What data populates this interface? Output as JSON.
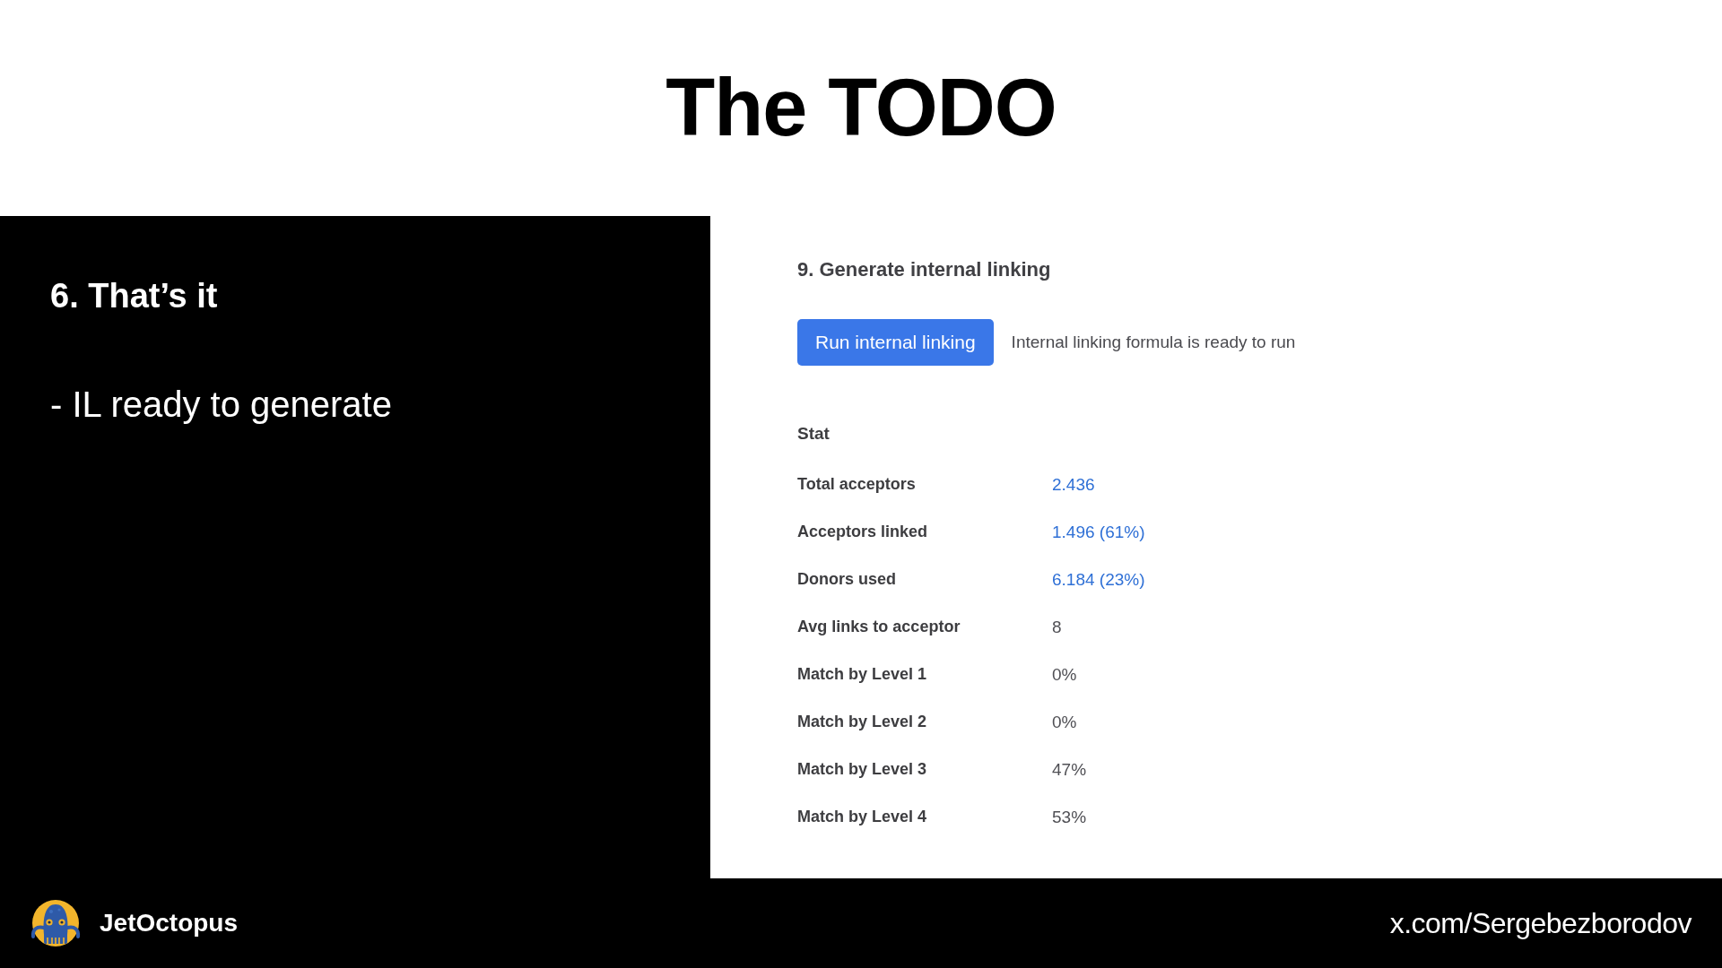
{
  "title": "The TODO",
  "slide": {
    "heading": "6. That’s it",
    "bullets": [
      "- IL ready to generate"
    ]
  },
  "panel": {
    "section_title": "9. Generate internal linking",
    "run_button": "Run internal linking",
    "status_text": "Internal linking formula is ready to run",
    "stat_heading": "Stat",
    "stats": [
      {
        "label": "Total acceptors",
        "value": "2.436",
        "kind": "link"
      },
      {
        "label": "Acceptors linked",
        "value": "1.496 (61%)",
        "kind": "link"
      },
      {
        "label": "Donors used",
        "value": "6.184 (23%)",
        "kind": "link"
      },
      {
        "label": "Avg links to acceptor",
        "value": "8",
        "kind": "plain"
      },
      {
        "label": "Match by Level 1",
        "value": "0%",
        "kind": "plain"
      },
      {
        "label": "Match by Level 2",
        "value": "0%",
        "kind": "plain"
      },
      {
        "label": "Match by Level 3",
        "value": "47%",
        "kind": "plain"
      },
      {
        "label": "Match by Level 4",
        "value": "53%",
        "kind": "plain"
      }
    ]
  },
  "footer": {
    "brand": "JetOctopus",
    "handle": "x.com/Sergebezborodov"
  }
}
